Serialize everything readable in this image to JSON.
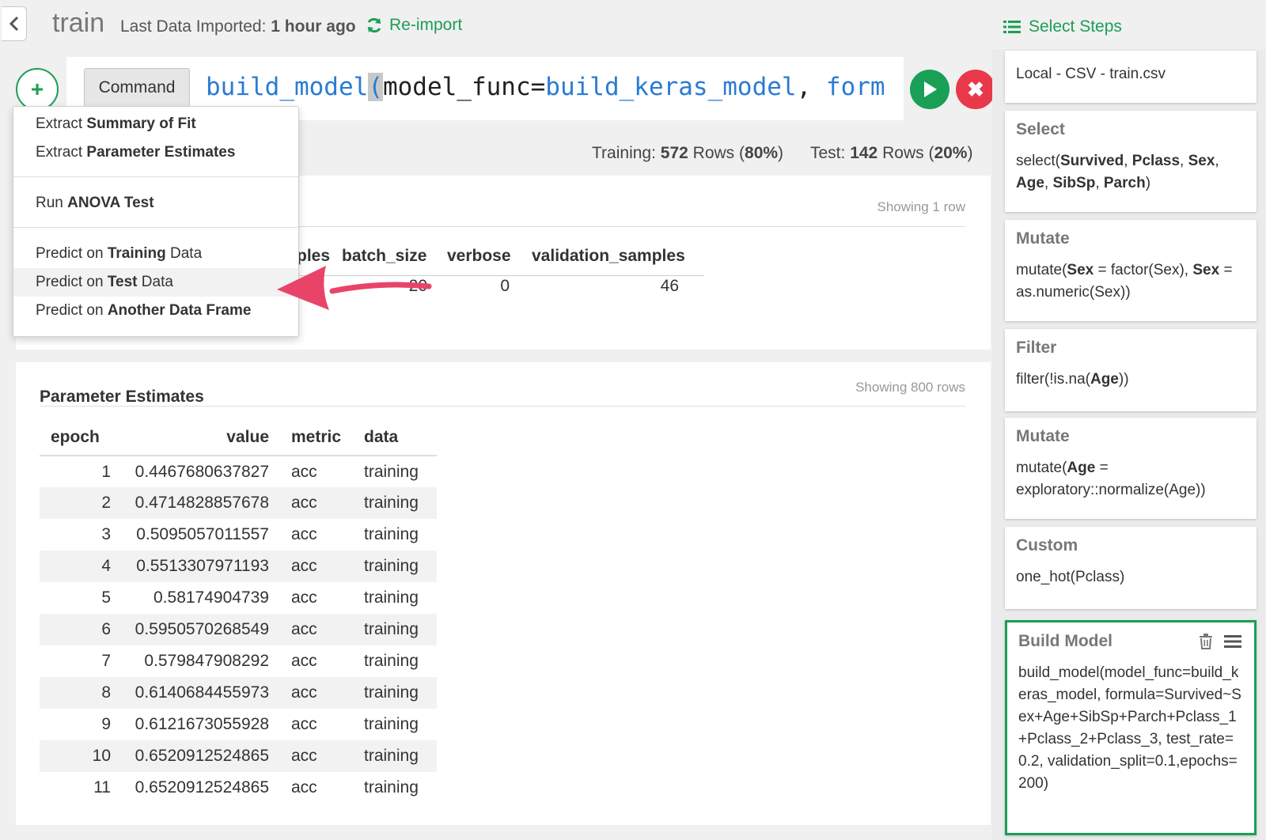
{
  "header": {
    "title": "train",
    "import_label": "Last Data Imported:",
    "import_time": "1 hour ago",
    "reimport_label": "Re-import",
    "select_steps_label": "Select Steps"
  },
  "command": {
    "button_label": "Command",
    "code_fn": "build_model",
    "code_paren": "(",
    "code_arg": "model_func=",
    "code_arg_value": "build_keras_model",
    "code_comma": ", ",
    "code_rest": "form"
  },
  "split": {
    "training_label": "Training:",
    "training_rows": "572",
    "training_rows_unit": "Rows",
    "training_pct": "80%",
    "test_label": "Test:",
    "test_rows": "142",
    "test_rows_unit": "Rows",
    "test_pct": "20%"
  },
  "summary": {
    "showing": "Showing 1 row",
    "headers": [
      "ples",
      "batch_size",
      "verbose",
      "validation_samples"
    ],
    "values": [
      "20",
      "0",
      "46"
    ]
  },
  "dropdown": {
    "items": [
      {
        "prefix": "Extract ",
        "bold": "Summary of Fit",
        "suffix": ""
      },
      {
        "prefix": "Extract ",
        "bold": "Parameter Estimates",
        "suffix": ""
      },
      {
        "prefix": "Run ",
        "bold": "ANOVA Test",
        "suffix": ""
      },
      {
        "prefix": "Predict on ",
        "bold": "Training",
        "suffix": " Data"
      },
      {
        "prefix": "Predict on ",
        "bold": "Test",
        "suffix": " Data"
      },
      {
        "prefix": "Predict on ",
        "bold": "Another Data Frame",
        "suffix": ""
      }
    ]
  },
  "params": {
    "title": "Parameter Estimates",
    "showing": "Showing 800 rows",
    "columns": [
      "epoch",
      "value",
      "metric",
      "data"
    ],
    "rows": [
      [
        "1",
        "0.4467680637827",
        "acc",
        "training"
      ],
      [
        "2",
        "0.4714828857678",
        "acc",
        "training"
      ],
      [
        "3",
        "0.5095057011557",
        "acc",
        "training"
      ],
      [
        "4",
        "0.5513307971193",
        "acc",
        "training"
      ],
      [
        "5",
        "0.58174904739",
        "acc",
        "training"
      ],
      [
        "6",
        "0.5950570268549",
        "acc",
        "training"
      ],
      [
        "7",
        "0.579847908292",
        "acc",
        "training"
      ],
      [
        "8",
        "0.6140684455973",
        "acc",
        "training"
      ],
      [
        "9",
        "0.6121673055928",
        "acc",
        "training"
      ],
      [
        "10",
        "0.6520912524865",
        "acc",
        "training"
      ],
      [
        "11",
        "0.6520912524865",
        "acc",
        "training"
      ]
    ]
  },
  "steps": {
    "source_body": "Local - CSV - train.csv",
    "select_title": "Select",
    "select_parts": [
      "select(",
      "Survived",
      ", ",
      "Pclass",
      ", ",
      "Sex",
      ", ",
      "Age",
      ", ",
      "SibSp",
      ", ",
      "Parch",
      ")"
    ],
    "mutate1_title": "Mutate",
    "mutate1_parts": [
      "mutate(",
      "Sex",
      " = factor(Sex), ",
      "Sex",
      " = as.numeric(Sex))"
    ],
    "filter_title": "Filter",
    "filter_parts": [
      "filter(!is.na(",
      "Age",
      "))"
    ],
    "mutate2_title": "Mutate",
    "mutate2_parts": [
      "mutate(",
      "Age",
      " = exploratory::normalize(Age))"
    ],
    "custom_title": "Custom",
    "custom_body": "one_hot(Pclass)",
    "build_title": "Build Model",
    "build_body": "build_model(model_func=build_keras_model, formula=Survived~Sex+Age+SibSp+Parch+Pclass_1+Pclass_2+Pclass_3, test_rate=0.2, validation_split=0.1,epochs=200)"
  }
}
